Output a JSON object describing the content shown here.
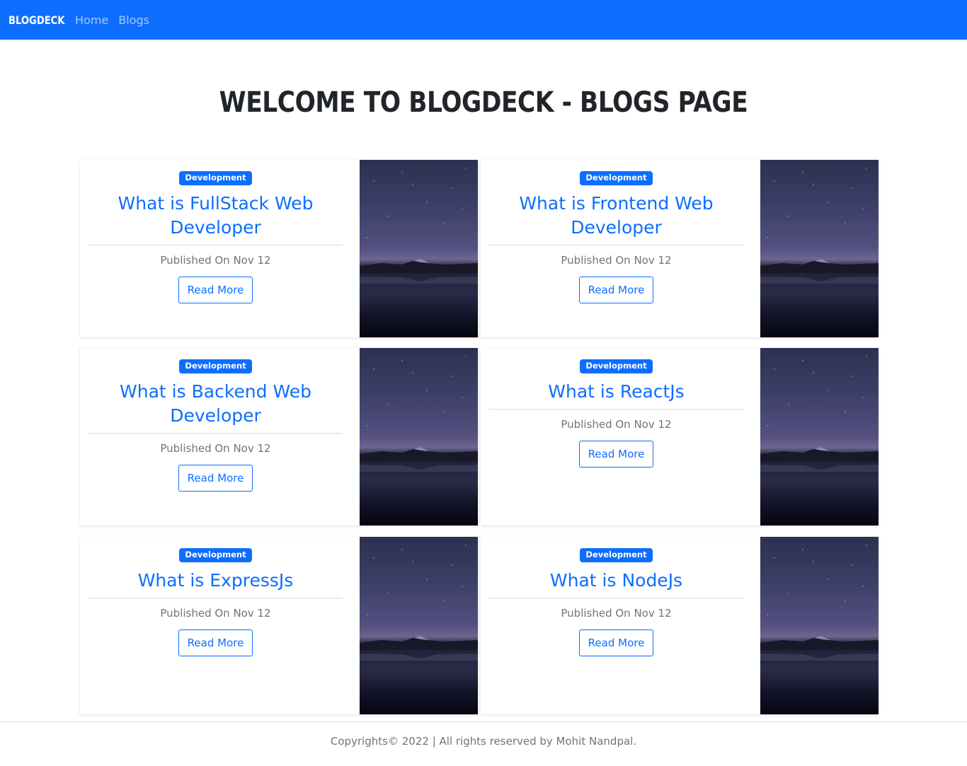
{
  "navbar": {
    "brand": "BLOGDECK",
    "links": [
      "Home",
      "Blogs"
    ]
  },
  "page_title": "Welcome To BlogDeck - Blogs Page",
  "cards": [
    {
      "badge": "Development",
      "title": "What is FullStack Web Developer",
      "published": "Published On Nov 12",
      "button": "Read More"
    },
    {
      "badge": "Development",
      "title": "What is Frontend Web Developer",
      "published": "Published On Nov 12",
      "button": "Read More"
    },
    {
      "badge": "Development",
      "title": "What is Backend Web Developer",
      "published": "Published On Nov 12",
      "button": "Read More"
    },
    {
      "badge": "Development",
      "title": "What is ReactJs",
      "published": "Published On Nov 12",
      "button": "Read More"
    },
    {
      "badge": "Development",
      "title": "What is ExpressJs",
      "published": "Published On Nov 12",
      "button": "Read More"
    },
    {
      "badge": "Development",
      "title": "What is NodeJs",
      "published": "Published On Nov 12",
      "button": "Read More"
    }
  ],
  "footer": "Copyrights© 2022 | All rights reserved by Mohit Nandpal.",
  "colors": {
    "primary": "#0d6efd",
    "muted_text": "#6c757d",
    "heading_text": "#212529"
  },
  "icons": {
    "card_image": "night-lake-mountain-image"
  }
}
